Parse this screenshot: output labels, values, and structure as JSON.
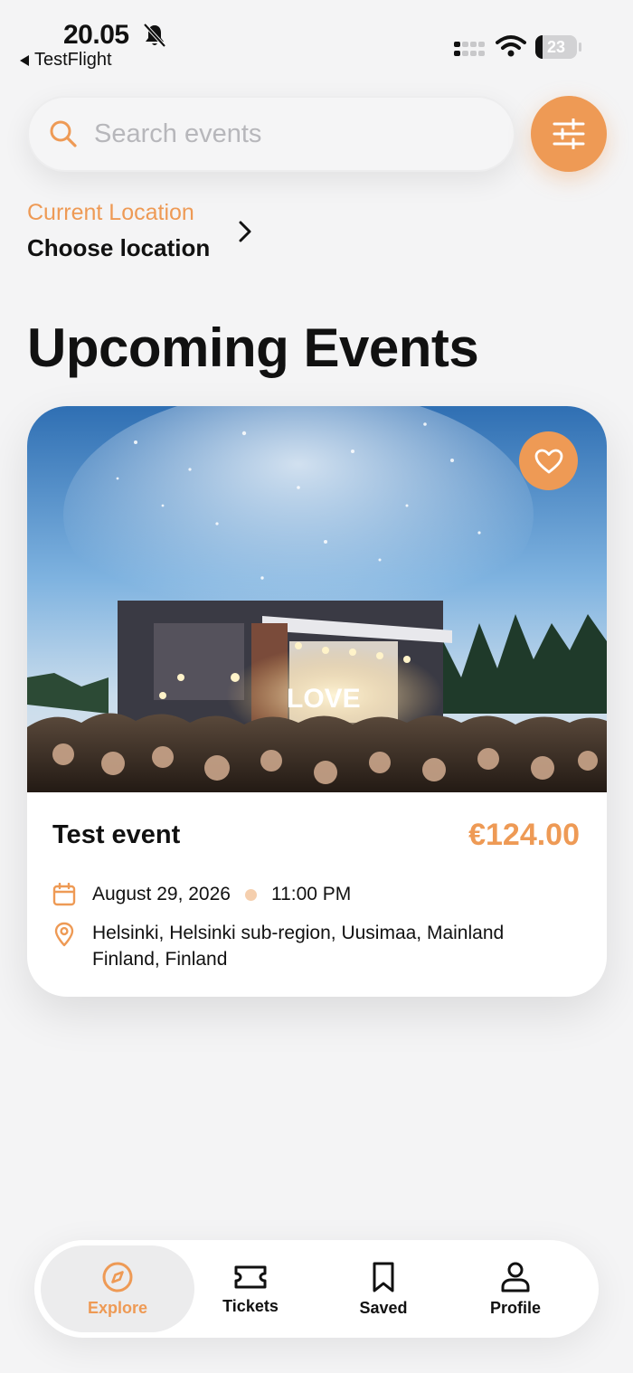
{
  "status_bar": {
    "time": "20.05",
    "back_app": "TestFlight",
    "battery": "23"
  },
  "search": {
    "placeholder": "Search events"
  },
  "location": {
    "label": "Current Location",
    "value": "Choose location"
  },
  "page_title": "Upcoming Events",
  "events": [
    {
      "name": "Test event",
      "price": "€124.00",
      "date": "August 29, 2026",
      "time": "11:00 PM",
      "place": "Helsinki, Helsinki sub-region, Uusimaa, Mainland Finland, Finland",
      "image_sign": "LOVE"
    }
  ],
  "tabs": [
    {
      "label": "Explore",
      "icon": "compass-icon",
      "active": true
    },
    {
      "label": "Tickets",
      "icon": "ticket-icon",
      "active": false
    },
    {
      "label": "Saved",
      "icon": "bookmark-icon",
      "active": false
    },
    {
      "label": "Profile",
      "icon": "person-icon",
      "active": false
    }
  ],
  "colors": {
    "accent": "#ee9a55",
    "background": "#f4f4f5"
  }
}
